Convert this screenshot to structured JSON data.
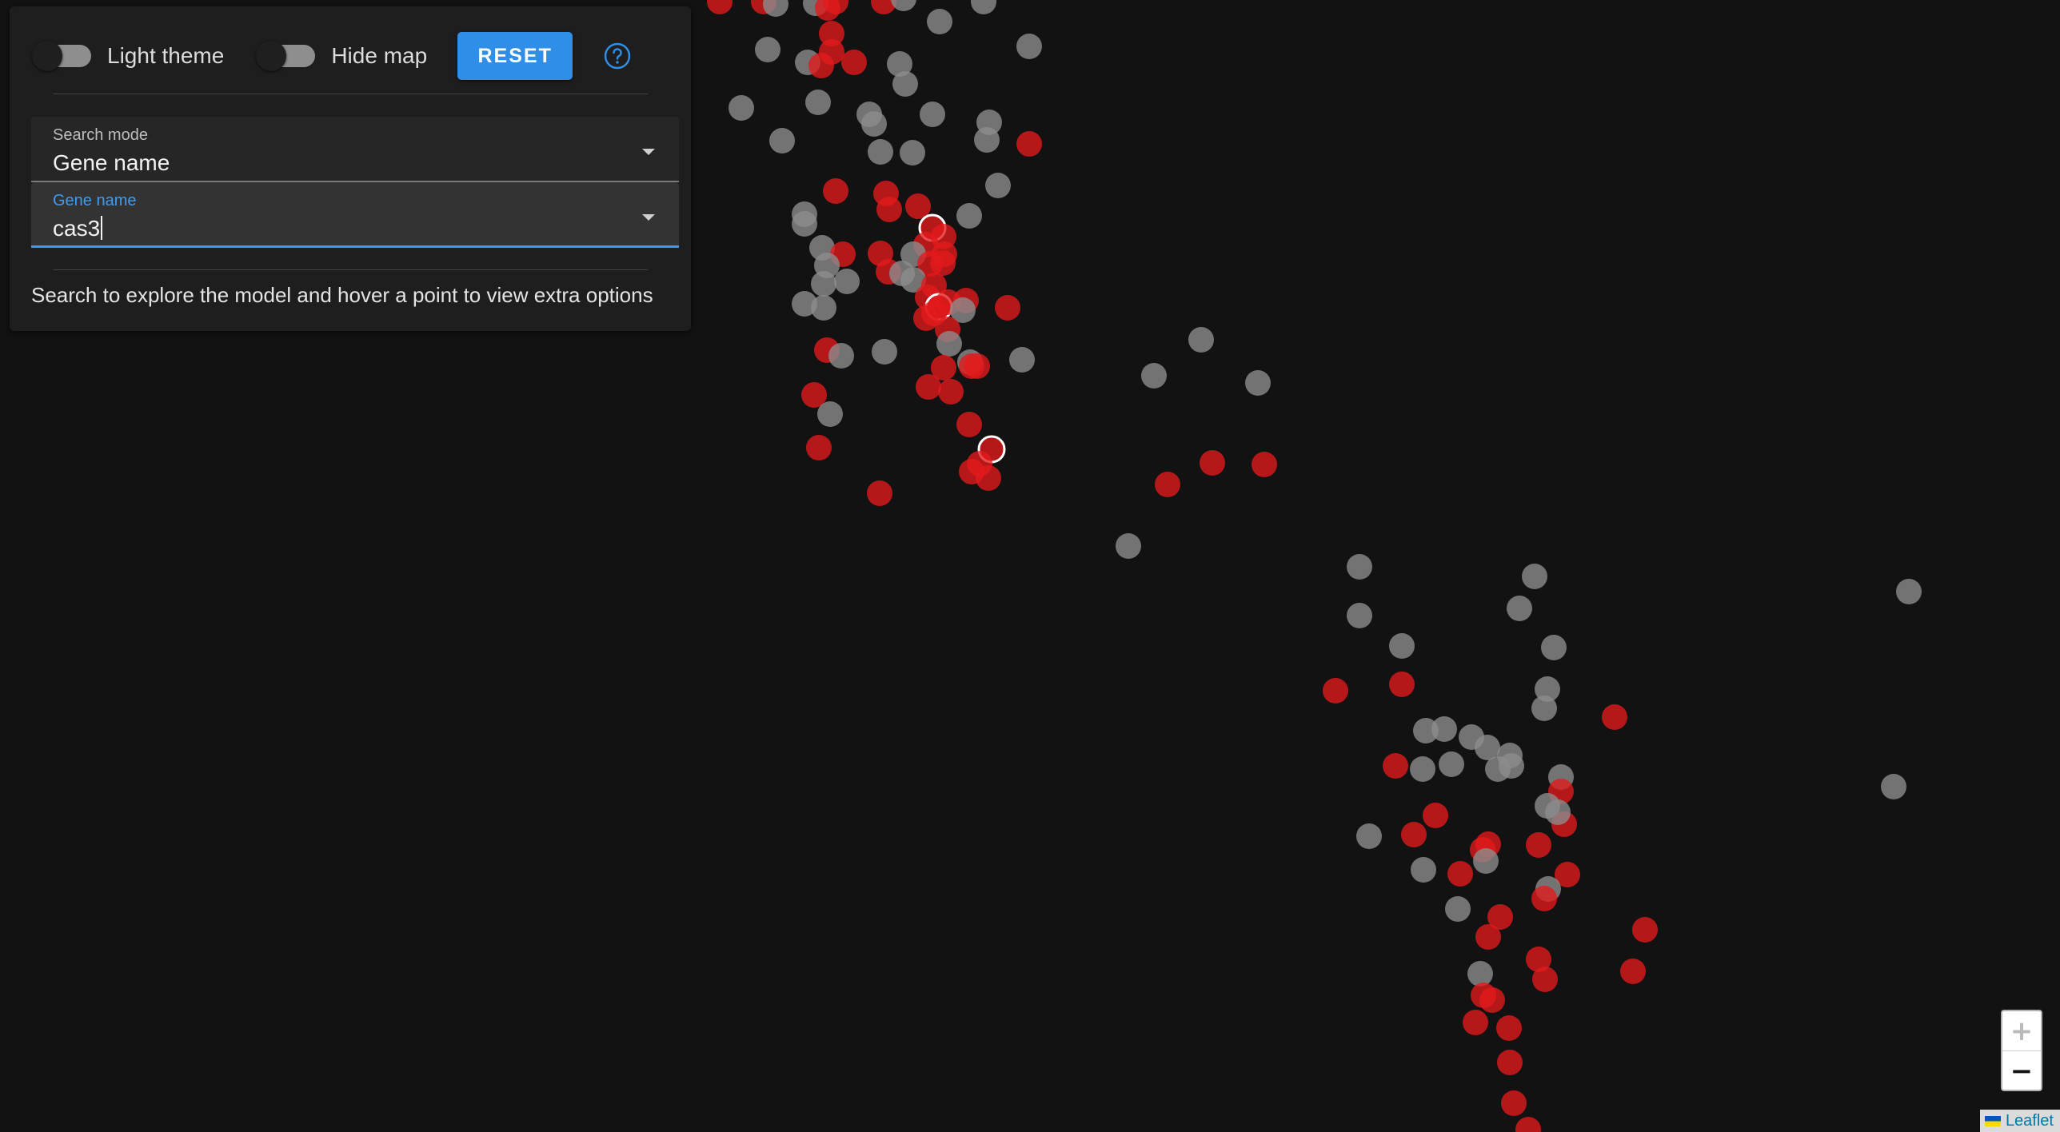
{
  "controls": {
    "light_theme_label": "Light theme",
    "light_theme_on": false,
    "hide_map_label": "Hide map",
    "hide_map_on": false,
    "reset_label": "RESET",
    "help_icon": "help-circle-icon"
  },
  "search_mode": {
    "label": "Search mode",
    "value": "Gene name"
  },
  "gene_name": {
    "label": "Gene name",
    "value": "cas3"
  },
  "hint": "Search to explore the model and hover a point to view extra options",
  "zoom": {
    "in_label": "+",
    "out_label": "−"
  },
  "attribution": {
    "label": "Leaflet",
    "flag_icon": "ukraine-flag-icon"
  },
  "colors": {
    "background": "#121212",
    "panel": "#1e1e1e",
    "accent": "#2f8fe8",
    "focus": "#3e9cf0",
    "point_match": "#e41a1c",
    "point_other": "#8c8c8c"
  }
}
